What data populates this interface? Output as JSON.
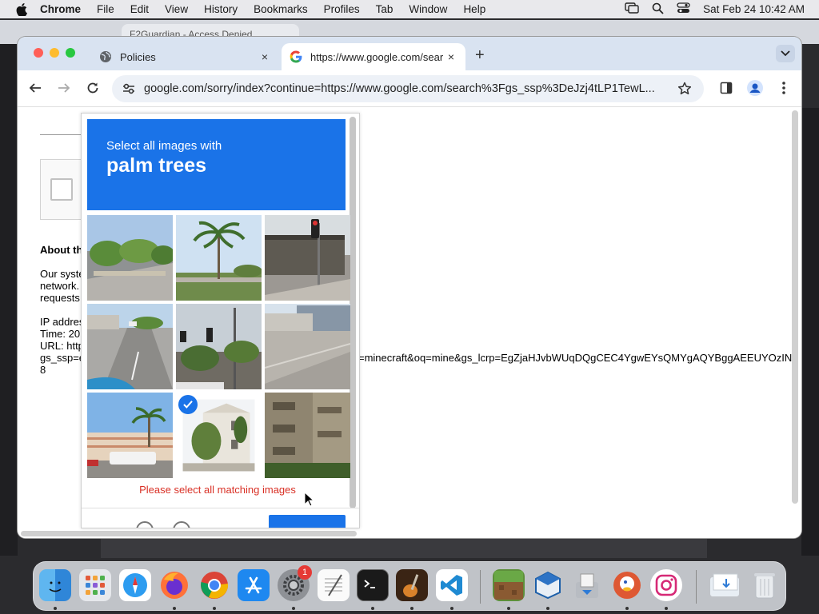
{
  "menubar": {
    "app": "Chrome",
    "items": [
      "File",
      "Edit",
      "View",
      "History",
      "Bookmarks",
      "Profiles",
      "Tab",
      "Window",
      "Help"
    ],
    "clock": "Sat Feb 24  10:42 AM"
  },
  "background_tab": {
    "title": "F2Guardian - Access Denied"
  },
  "browser": {
    "tabs": [
      {
        "title": "Policies",
        "close": "×"
      },
      {
        "title": "https://www.google.com/sear",
        "close": "×"
      }
    ],
    "new_tab": "+",
    "url": "google.com/sorry/index?continue=https://www.google.com/search%3Fgs_ssp%3DeJzj4tLP1TewL..."
  },
  "page": {
    "about_heading": "About th",
    "paragraph_lines": [
      "Our syste",
      "network.",
      "requests"
    ],
    "ip_lines": [
      "IP addres",
      "Time: 20",
      "URL: http",
      "gs_ssp=e",
      "8"
    ],
    "long_url_tail": "=minecraft&oq=mine&gs_lcrp=EgZjaHJvbWUqDQgCEC4YgwEYsQMYgAQYBggAEEUYOzIN("
  },
  "captcha": {
    "instruction": "Select all images with",
    "target": "palm trees",
    "error": "Please select all matching images",
    "selected_tiles": [
      7
    ],
    "tiles": [
      "street-with-trees",
      "palm-tree-overpass",
      "traffic-light-building",
      "road-with-cars",
      "traffic-light-palms",
      "parking-lot-buildings",
      "hotel-with-palms",
      "white-house-palm",
      "apartment-building"
    ]
  },
  "dock": {
    "apps": [
      "Finder",
      "Launchpad",
      "Safari",
      "Firefox",
      "Chrome",
      "App Store",
      "System Settings",
      "TextEdit",
      "Terminal",
      "Instruments",
      "Visual Studio Code",
      "Minecraft",
      "VirtualBox",
      "Preview",
      "DuckDuckGo",
      "Instagram",
      "Downloads",
      "Trash"
    ],
    "settings_badge": "1"
  },
  "colors": {
    "accent": "#1a73e8",
    "error": "#d93025",
    "tabstrip": "#d9e3f1"
  }
}
